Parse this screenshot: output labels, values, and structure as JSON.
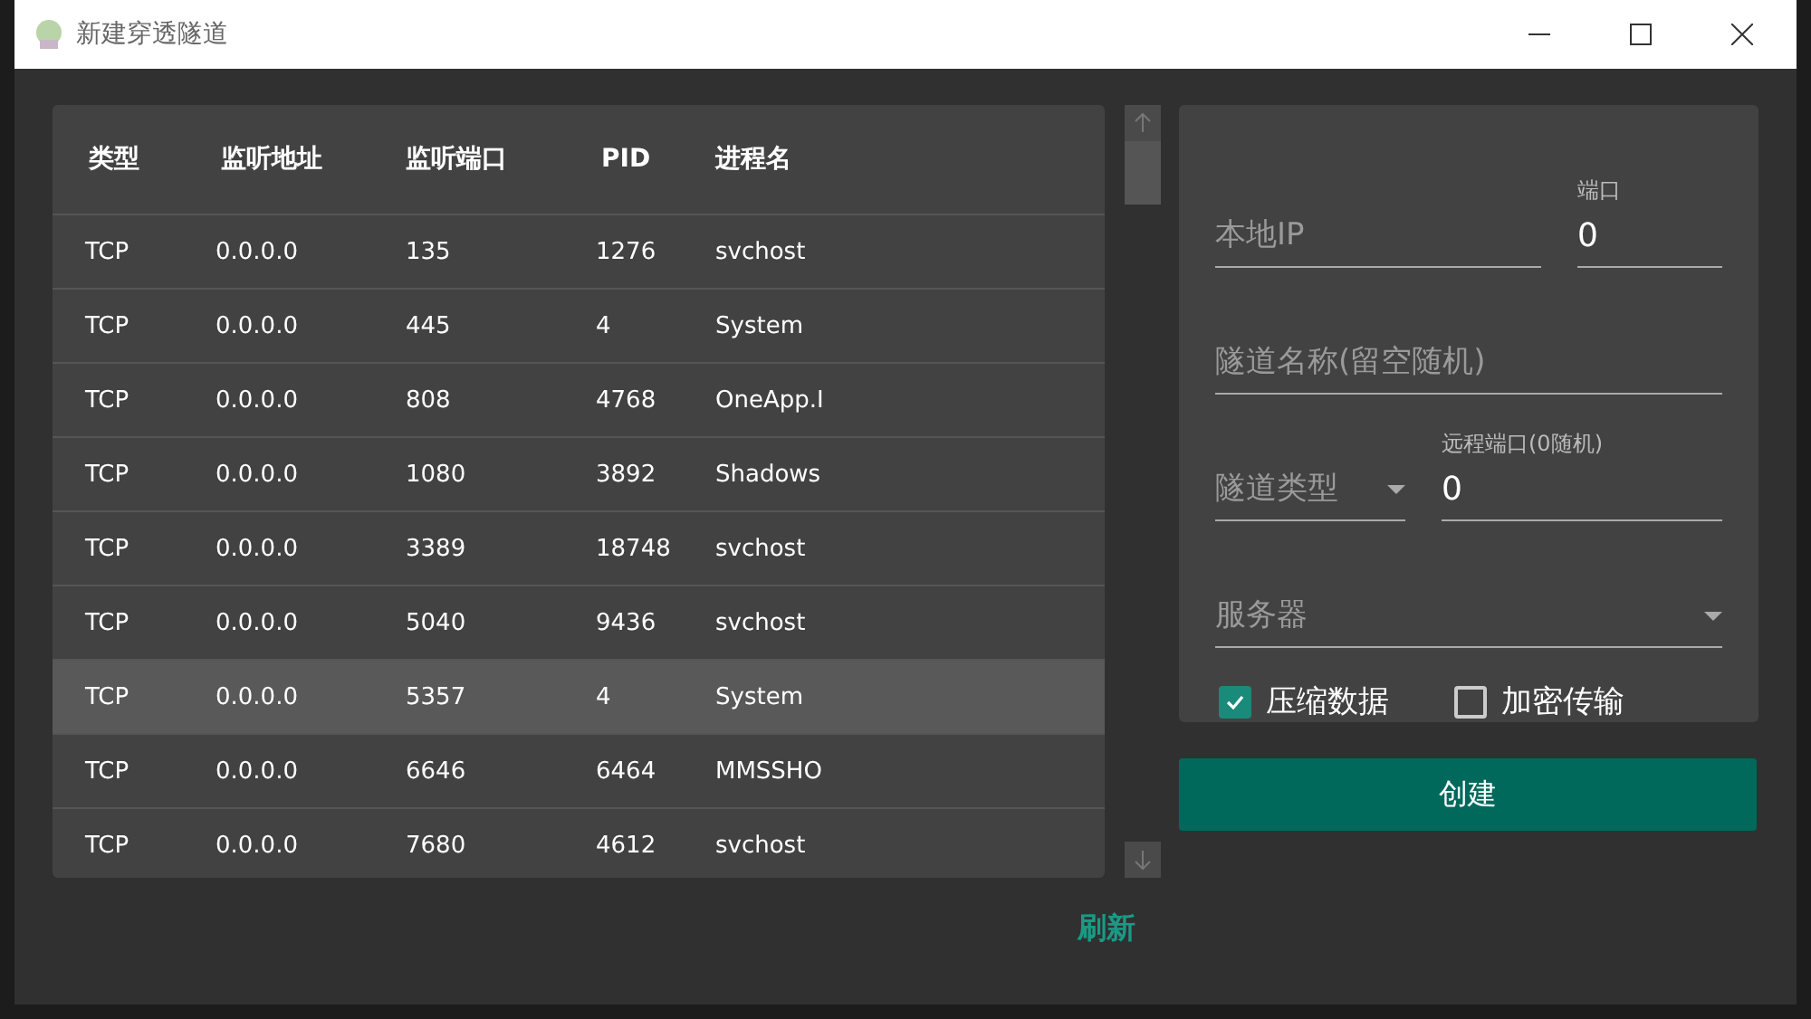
{
  "window": {
    "title": "新建穿透隧道"
  },
  "table": {
    "columns": [
      "类型",
      "监听地址",
      "监听端口",
      "PID",
      "进程名"
    ],
    "rows": [
      {
        "cells": [
          "TCP",
          "0.0.0.0",
          "135",
          "1276",
          "svchost"
        ],
        "selected": false
      },
      {
        "cells": [
          "TCP",
          "0.0.0.0",
          "445",
          "4",
          "System"
        ],
        "selected": false
      },
      {
        "cells": [
          "TCP",
          "0.0.0.0",
          "808",
          "4768",
          "OneApp.I"
        ],
        "selected": false
      },
      {
        "cells": [
          "TCP",
          "0.0.0.0",
          "1080",
          "3892",
          "Shadows"
        ],
        "selected": false
      },
      {
        "cells": [
          "TCP",
          "0.0.0.0",
          "3389",
          "18748",
          "svchost"
        ],
        "selected": false
      },
      {
        "cells": [
          "TCP",
          "0.0.0.0",
          "5040",
          "9436",
          "svchost"
        ],
        "selected": false
      },
      {
        "cells": [
          "TCP",
          "0.0.0.0",
          "5357",
          "4",
          "System"
        ],
        "selected": true
      },
      {
        "cells": [
          "TCP",
          "0.0.0.0",
          "6646",
          "6464",
          "MMSSHO"
        ],
        "selected": false
      },
      {
        "cells": [
          "TCP",
          "0.0.0.0",
          "7680",
          "4612",
          "svchost"
        ],
        "selected": false
      }
    ]
  },
  "refresh_button": "刷新",
  "form": {
    "local_ip": {
      "placeholder": "本地IP"
    },
    "port": {
      "label": "端口",
      "value": "0"
    },
    "tunnel_name": {
      "placeholder": "隧道名称(留空随机)"
    },
    "tunnel_type": {
      "placeholder": "隧道类型"
    },
    "remote_port": {
      "label": "远程端口(0随机)",
      "value": "0"
    },
    "server": {
      "placeholder": "服务器"
    },
    "checkboxes": [
      {
        "label": "压缩数据",
        "checked": true
      },
      {
        "label": "加密传输",
        "checked": false
      }
    ]
  },
  "create_button": "创建"
}
